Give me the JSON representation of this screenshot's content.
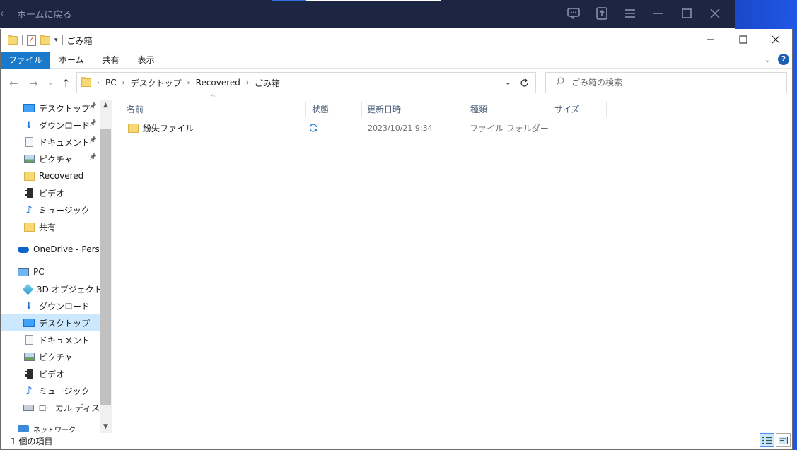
{
  "host": {
    "back_label": "ホームに戻る"
  },
  "window": {
    "title": "ごみ箱"
  },
  "ribbon": {
    "tabs": [
      "ファイル",
      "ホーム",
      "共有",
      "表示"
    ]
  },
  "address": {
    "crumbs": [
      "PC",
      "デスクトップ",
      "Recovered",
      "ごみ箱"
    ]
  },
  "search": {
    "placeholder": "ごみ箱の検索"
  },
  "nav": {
    "quick": [
      {
        "label": "デスクトップ",
        "icon": "desktop-icon",
        "pinned": true
      },
      {
        "label": "ダウンロード",
        "icon": "download-icon",
        "pinned": true
      },
      {
        "label": "ドキュメント",
        "icon": "document-icon",
        "pinned": true
      },
      {
        "label": "ピクチャ",
        "icon": "pictures-icon",
        "pinned": true
      },
      {
        "label": "Recovered",
        "icon": "folder-icon",
        "pinned": false
      },
      {
        "label": "ビデオ",
        "icon": "video-icon",
        "pinned": false
      },
      {
        "label": "ミュージック",
        "icon": "music-icon",
        "pinned": false
      },
      {
        "label": "共有",
        "icon": "folder-icon",
        "pinned": false
      }
    ],
    "onedrive": "OneDrive - Persor",
    "pc": "PC",
    "pc_items": [
      {
        "label": "3D オブジェクト",
        "icon": "3d-objects-icon"
      },
      {
        "label": "ダウンロード",
        "icon": "download-icon"
      },
      {
        "label": "デスクトップ",
        "icon": "desktop-icon",
        "selected": true
      },
      {
        "label": "ドキュメント",
        "icon": "document-icon"
      },
      {
        "label": "ピクチャ",
        "icon": "pictures-icon"
      },
      {
        "label": "ビデオ",
        "icon": "video-icon"
      },
      {
        "label": "ミュージック",
        "icon": "music-icon"
      },
      {
        "label": "ローカル ディスク (C",
        "icon": "local-disk-icon"
      }
    ],
    "network": "ネットワーク"
  },
  "columns": {
    "name": "名前",
    "status": "状態",
    "date": "更新日時",
    "type": "種類",
    "size": "サイズ"
  },
  "files": [
    {
      "name": "紛失ファイル",
      "date": "2023/10/21 9:34",
      "type": "ファイル フォルダー",
      "status_icon": "sync-icon"
    }
  ],
  "statusbar": {
    "count": "1 個の項目"
  },
  "colors": {
    "accent": "#1979ca",
    "host_bg": "#1c2541",
    "selection": "#cce8ff"
  }
}
